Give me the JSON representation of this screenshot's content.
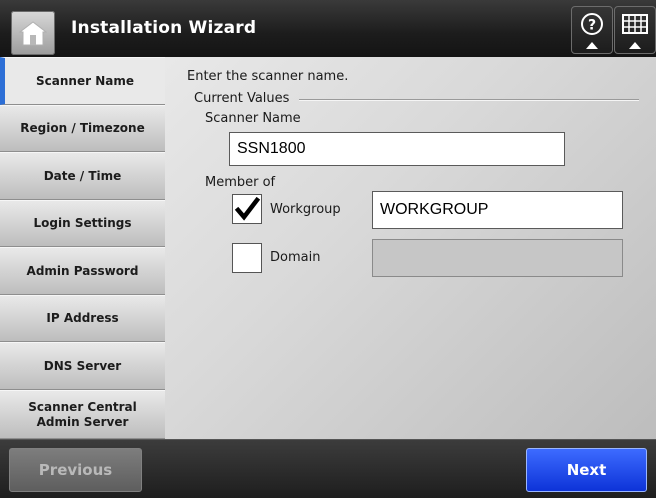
{
  "header": {
    "title": "Installation Wizard",
    "home_icon": "home-icon",
    "help_icon": "help-icon",
    "keyboard_icon": "keyboard-icon"
  },
  "sidebar": {
    "items": [
      {
        "label": "Scanner Name",
        "active": true
      },
      {
        "label": "Region / Timezone",
        "active": false
      },
      {
        "label": "Date / Time",
        "active": false
      },
      {
        "label": "Login Settings",
        "active": false
      },
      {
        "label": "Admin Password",
        "active": false
      },
      {
        "label": "IP Address",
        "active": false
      },
      {
        "label": "DNS Server",
        "active": false
      },
      {
        "label": "Scanner Central\nAdmin Server",
        "active": false
      }
    ],
    "active_color": "#2d6fd6"
  },
  "main": {
    "instruction": "Enter the scanner name.",
    "group_label": "Current Values",
    "scanner_name_label": "Scanner Name",
    "scanner_name_value": "SSN1800",
    "member_of_label": "Member of",
    "workgroup": {
      "label": "Workgroup",
      "checked": true,
      "value": "WORKGROUP"
    },
    "domain": {
      "label": "Domain",
      "checked": false,
      "value": ""
    }
  },
  "footer": {
    "previous_label": "Previous",
    "next_label": "Next",
    "next_color": "#1f4ef0"
  }
}
